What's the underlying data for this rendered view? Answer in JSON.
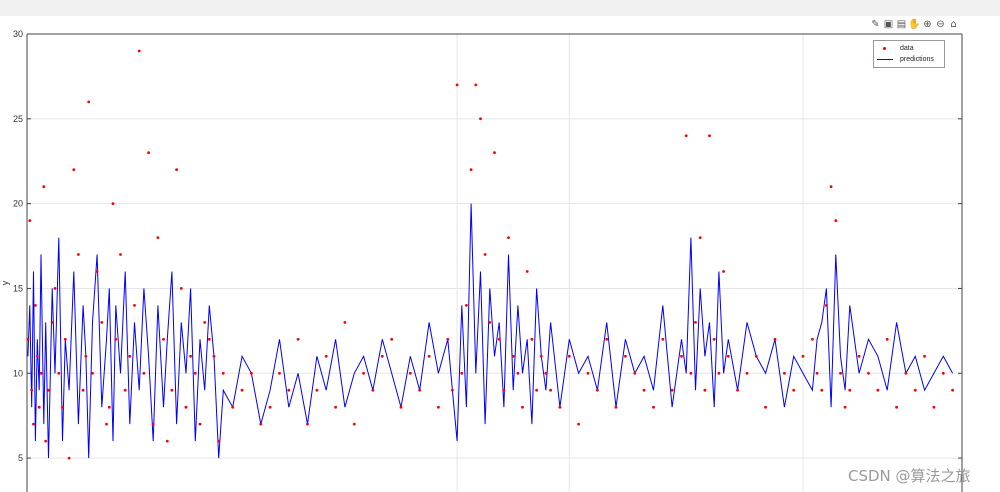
{
  "toolbar": {
    "icons": [
      "brush-icon",
      "datatip-icon",
      "rotate-icon",
      "pan-icon",
      "zoom-in-icon",
      "zoom-out-icon",
      "home-icon"
    ]
  },
  "watermark": "CSDN @算法之旅",
  "chart_data": {
    "type": "scatter",
    "ylabel": "y",
    "xlabel": "",
    "ylim": [
      3,
      30
    ],
    "xlim": [
      0,
      1000
    ],
    "yticks": [
      "5",
      "10",
      "15",
      "20",
      "25",
      "30"
    ],
    "ytick_values": [
      5,
      10,
      15,
      20,
      25,
      30
    ],
    "grid": true,
    "legend_position": "top-right",
    "colors": {
      "data": "#ff0000",
      "predictions": "#0000ff"
    },
    "series": [
      {
        "name": "data",
        "style": "red dots",
        "x": [
          1,
          3,
          5,
          7,
          9,
          11,
          13,
          15,
          18,
          20,
          23,
          27,
          30,
          34,
          38,
          41,
          45,
          50,
          55,
          60,
          63,
          66,
          70,
          75,
          80,
          85,
          88,
          92,
          95,
          100,
          105,
          110,
          115,
          120,
          125,
          130,
          135,
          140,
          146,
          150,
          155,
          160,
          165,
          170,
          175,
          180,
          185,
          190,
          195,
          200,
          205,
          210,
          220,
          230,
          240,
          250,
          260,
          270,
          280,
          290,
          300,
          310,
          320,
          330,
          340,
          350,
          360,
          370,
          380,
          390,
          400,
          410,
          420,
          430,
          440,
          450,
          455,
          460,
          465,
          470,
          475,
          480,
          485,
          490,
          495,
          500,
          505,
          510,
          515,
          520,
          525,
          530,
          535,
          540,
          545,
          550,
          555,
          560,
          570,
          580,
          590,
          600,
          610,
          620,
          630,
          640,
          650,
          660,
          670,
          680,
          690,
          700,
          705,
          710,
          715,
          720,
          725,
          730,
          735,
          740,
          745,
          750,
          760,
          770,
          780,
          790,
          800,
          810,
          820,
          830,
          840,
          845,
          850,
          855,
          860,
          865,
          870,
          875,
          880,
          890,
          900,
          910,
          920,
          930,
          940,
          950,
          960,
          970,
          980,
          990
        ],
        "y": [
          12,
          19,
          9,
          7,
          14,
          11,
          8,
          10,
          21,
          6,
          9,
          13,
          15,
          10,
          8,
          12,
          5,
          22,
          17,
          9,
          11,
          26,
          10,
          16,
          13,
          7,
          8,
          20,
          12,
          17,
          9,
          11,
          14,
          29,
          10,
          23,
          7,
          18,
          12,
          6,
          9,
          22,
          15,
          8,
          11,
          10,
          7,
          13,
          12,
          11,
          6,
          10,
          8,
          9,
          10,
          7,
          8,
          10,
          9,
          12,
          7,
          9,
          11,
          8,
          13,
          7,
          10,
          9,
          11,
          12,
          8,
          10,
          9,
          11,
          8,
          12,
          9,
          27,
          10,
          14,
          22,
          27,
          25,
          17,
          13,
          23,
          12,
          9,
          18,
          11,
          10,
          8,
          16,
          12,
          9,
          11,
          10,
          9,
          8,
          11,
          7,
          10,
          9,
          12,
          8,
          11,
          10,
          9,
          8,
          12,
          9,
          11,
          24,
          10,
          13,
          18,
          9,
          24,
          12,
          10,
          16,
          11,
          9,
          10,
          11,
          8,
          12,
          10,
          9,
          11,
          12,
          10,
          9,
          14,
          21,
          19,
          10,
          8,
          9,
          11,
          10,
          9,
          12,
          8,
          10,
          9,
          11,
          8,
          10,
          9
        ]
      },
      {
        "name": "predictions",
        "style": "blue line",
        "x": [
          1,
          3,
          5,
          7,
          9,
          11,
          13,
          15,
          18,
          20,
          23,
          27,
          30,
          34,
          38,
          41,
          45,
          50,
          55,
          60,
          63,
          66,
          70,
          75,
          80,
          85,
          88,
          92,
          95,
          100,
          105,
          110,
          115,
          120,
          125,
          130,
          135,
          140,
          146,
          150,
          155,
          160,
          165,
          170,
          175,
          180,
          185,
          190,
          195,
          200,
          205,
          210,
          220,
          230,
          240,
          250,
          260,
          270,
          280,
          290,
          300,
          310,
          320,
          330,
          340,
          350,
          360,
          370,
          380,
          390,
          400,
          410,
          420,
          430,
          440,
          450,
          455,
          460,
          465,
          470,
          475,
          480,
          485,
          490,
          495,
          500,
          505,
          510,
          515,
          520,
          525,
          530,
          535,
          540,
          545,
          550,
          555,
          560,
          570,
          580,
          590,
          600,
          610,
          620,
          630,
          640,
          650,
          660,
          670,
          680,
          690,
          700,
          705,
          710,
          715,
          720,
          725,
          730,
          735,
          740,
          745,
          750,
          760,
          770,
          780,
          790,
          800,
          810,
          820,
          830,
          840,
          845,
          850,
          855,
          860,
          865,
          870,
          875,
          880,
          890,
          900,
          910,
          920,
          930,
          940,
          950,
          960,
          970,
          980,
          990
        ],
        "y": [
          11,
          14,
          8,
          16,
          6,
          12,
          9,
          17,
          7,
          13,
          5,
          15,
          10,
          18,
          6,
          12,
          9,
          16,
          7,
          14,
          11,
          5,
          13,
          17,
          8,
          12,
          15,
          6,
          14,
          10,
          16,
          7,
          13,
          9,
          15,
          11,
          6,
          14,
          8,
          12,
          16,
          7,
          13,
          10,
          15,
          6,
          12,
          9,
          14,
          11,
          5,
          9,
          8,
          11,
          10,
          7,
          9,
          12,
          8,
          10,
          7,
          11,
          9,
          12,
          8,
          10,
          11,
          9,
          12,
          10,
          8,
          11,
          9,
          13,
          10,
          12,
          9,
          6,
          14,
          8,
          20,
          10,
          16,
          7,
          15,
          11,
          13,
          8,
          17,
          9,
          14,
          10,
          12,
          7,
          15,
          11,
          9,
          13,
          8,
          12,
          10,
          11,
          9,
          13,
          8,
          12,
          10,
          11,
          9,
          14,
          8,
          12,
          10,
          18,
          9,
          15,
          11,
          13,
          8,
          16,
          10,
          12,
          9,
          13,
          11,
          10,
          12,
          8,
          11,
          10,
          9,
          12,
          13,
          15,
          8,
          17,
          11,
          9,
          14,
          10,
          12,
          11,
          9,
          13,
          10,
          11,
          9,
          10,
          11,
          10
        ]
      }
    ]
  }
}
